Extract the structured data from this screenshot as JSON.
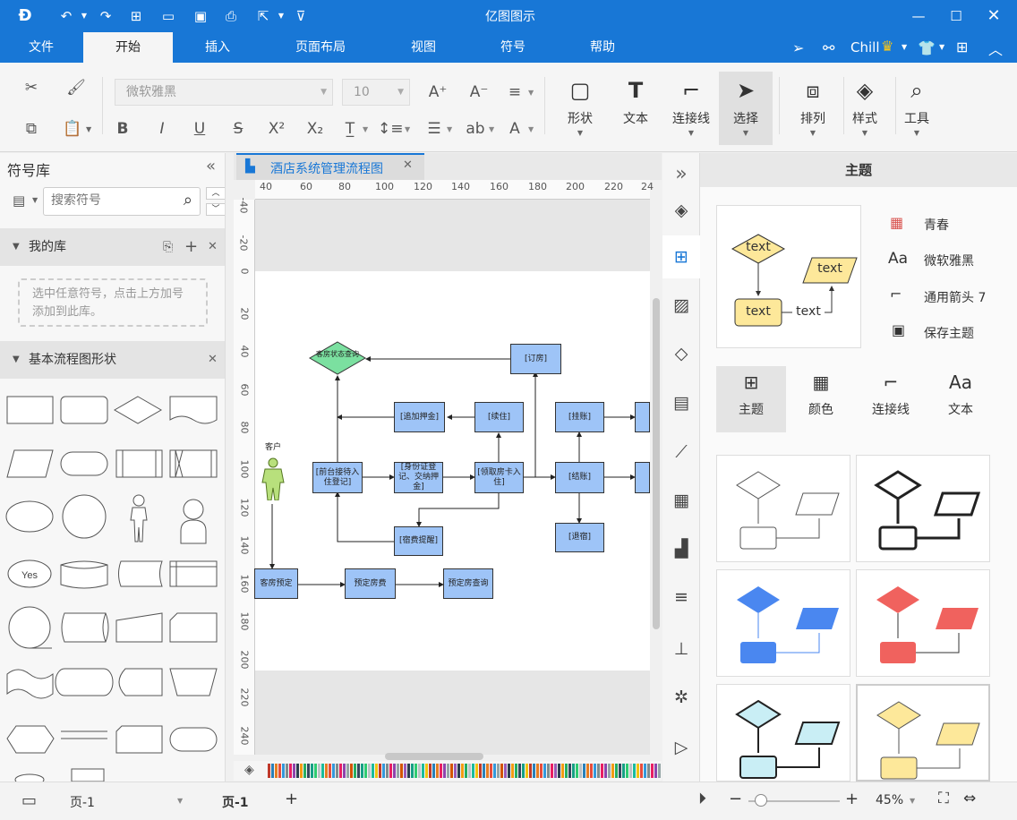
{
  "app": {
    "title": "亿图图示",
    "user": "Chill"
  },
  "menu": [
    "文件",
    "开始",
    "插入",
    "页面布局",
    "视图",
    "符号",
    "帮助"
  ],
  "ribbon": {
    "font_name": "微软雅黑",
    "font_size": "10",
    "big_buttons": [
      "形状",
      "文本",
      "连接线",
      "选择",
      "排列",
      "样式",
      "工具"
    ]
  },
  "left_panel": {
    "title": "符号库",
    "search_placeholder": "搜索符号",
    "my_library": "我的库",
    "my_library_hint": "选中任意符号，点击上方加号添加到此库。",
    "basic_shapes": "基本流程图形状",
    "yes_label": "Yes"
  },
  "doc_tab": {
    "name": "酒店系统管理流程图"
  },
  "ruler": {
    "h": [
      "40",
      "60",
      "80",
      "100",
      "120",
      "140",
      "160",
      "180",
      "200",
      "220",
      "24"
    ],
    "v": [
      "-40",
      "-20",
      "0",
      "20",
      "40",
      "60",
      "80",
      "100",
      "120",
      "140",
      "160",
      "180",
      "200",
      "220",
      "240"
    ]
  },
  "flow": {
    "customer": "客户",
    "nodes": {
      "room_status": "客房状态查询",
      "book": "[订房]",
      "extra_deposit": "[追加押金]",
      "extend": "[续住]",
      "charge": "[挂账]",
      "reception": "[前台接待入住登记]",
      "id_deposit": "[身份证登记、交纳押金]",
      "card": "[领取房卡入住]",
      "checkout": "[结账]",
      "fee_remind": "[宿费提醒]",
      "leave": "[退宿]",
      "reserve": "客房预定",
      "reserve_fee": "预定房费",
      "reserve_query": "预定房查询"
    }
  },
  "right_panel": {
    "title": "主题",
    "props": [
      "青春",
      "微软雅黑",
      "通用箭头 7",
      "保存主题"
    ],
    "preview_texts": [
      "text",
      "text",
      "text",
      "text"
    ],
    "tabs": [
      "主题",
      "颜色",
      "连接线",
      "文本"
    ]
  },
  "status": {
    "page_select": "页-1",
    "page_tab": "页-1",
    "zoom": "45%"
  }
}
